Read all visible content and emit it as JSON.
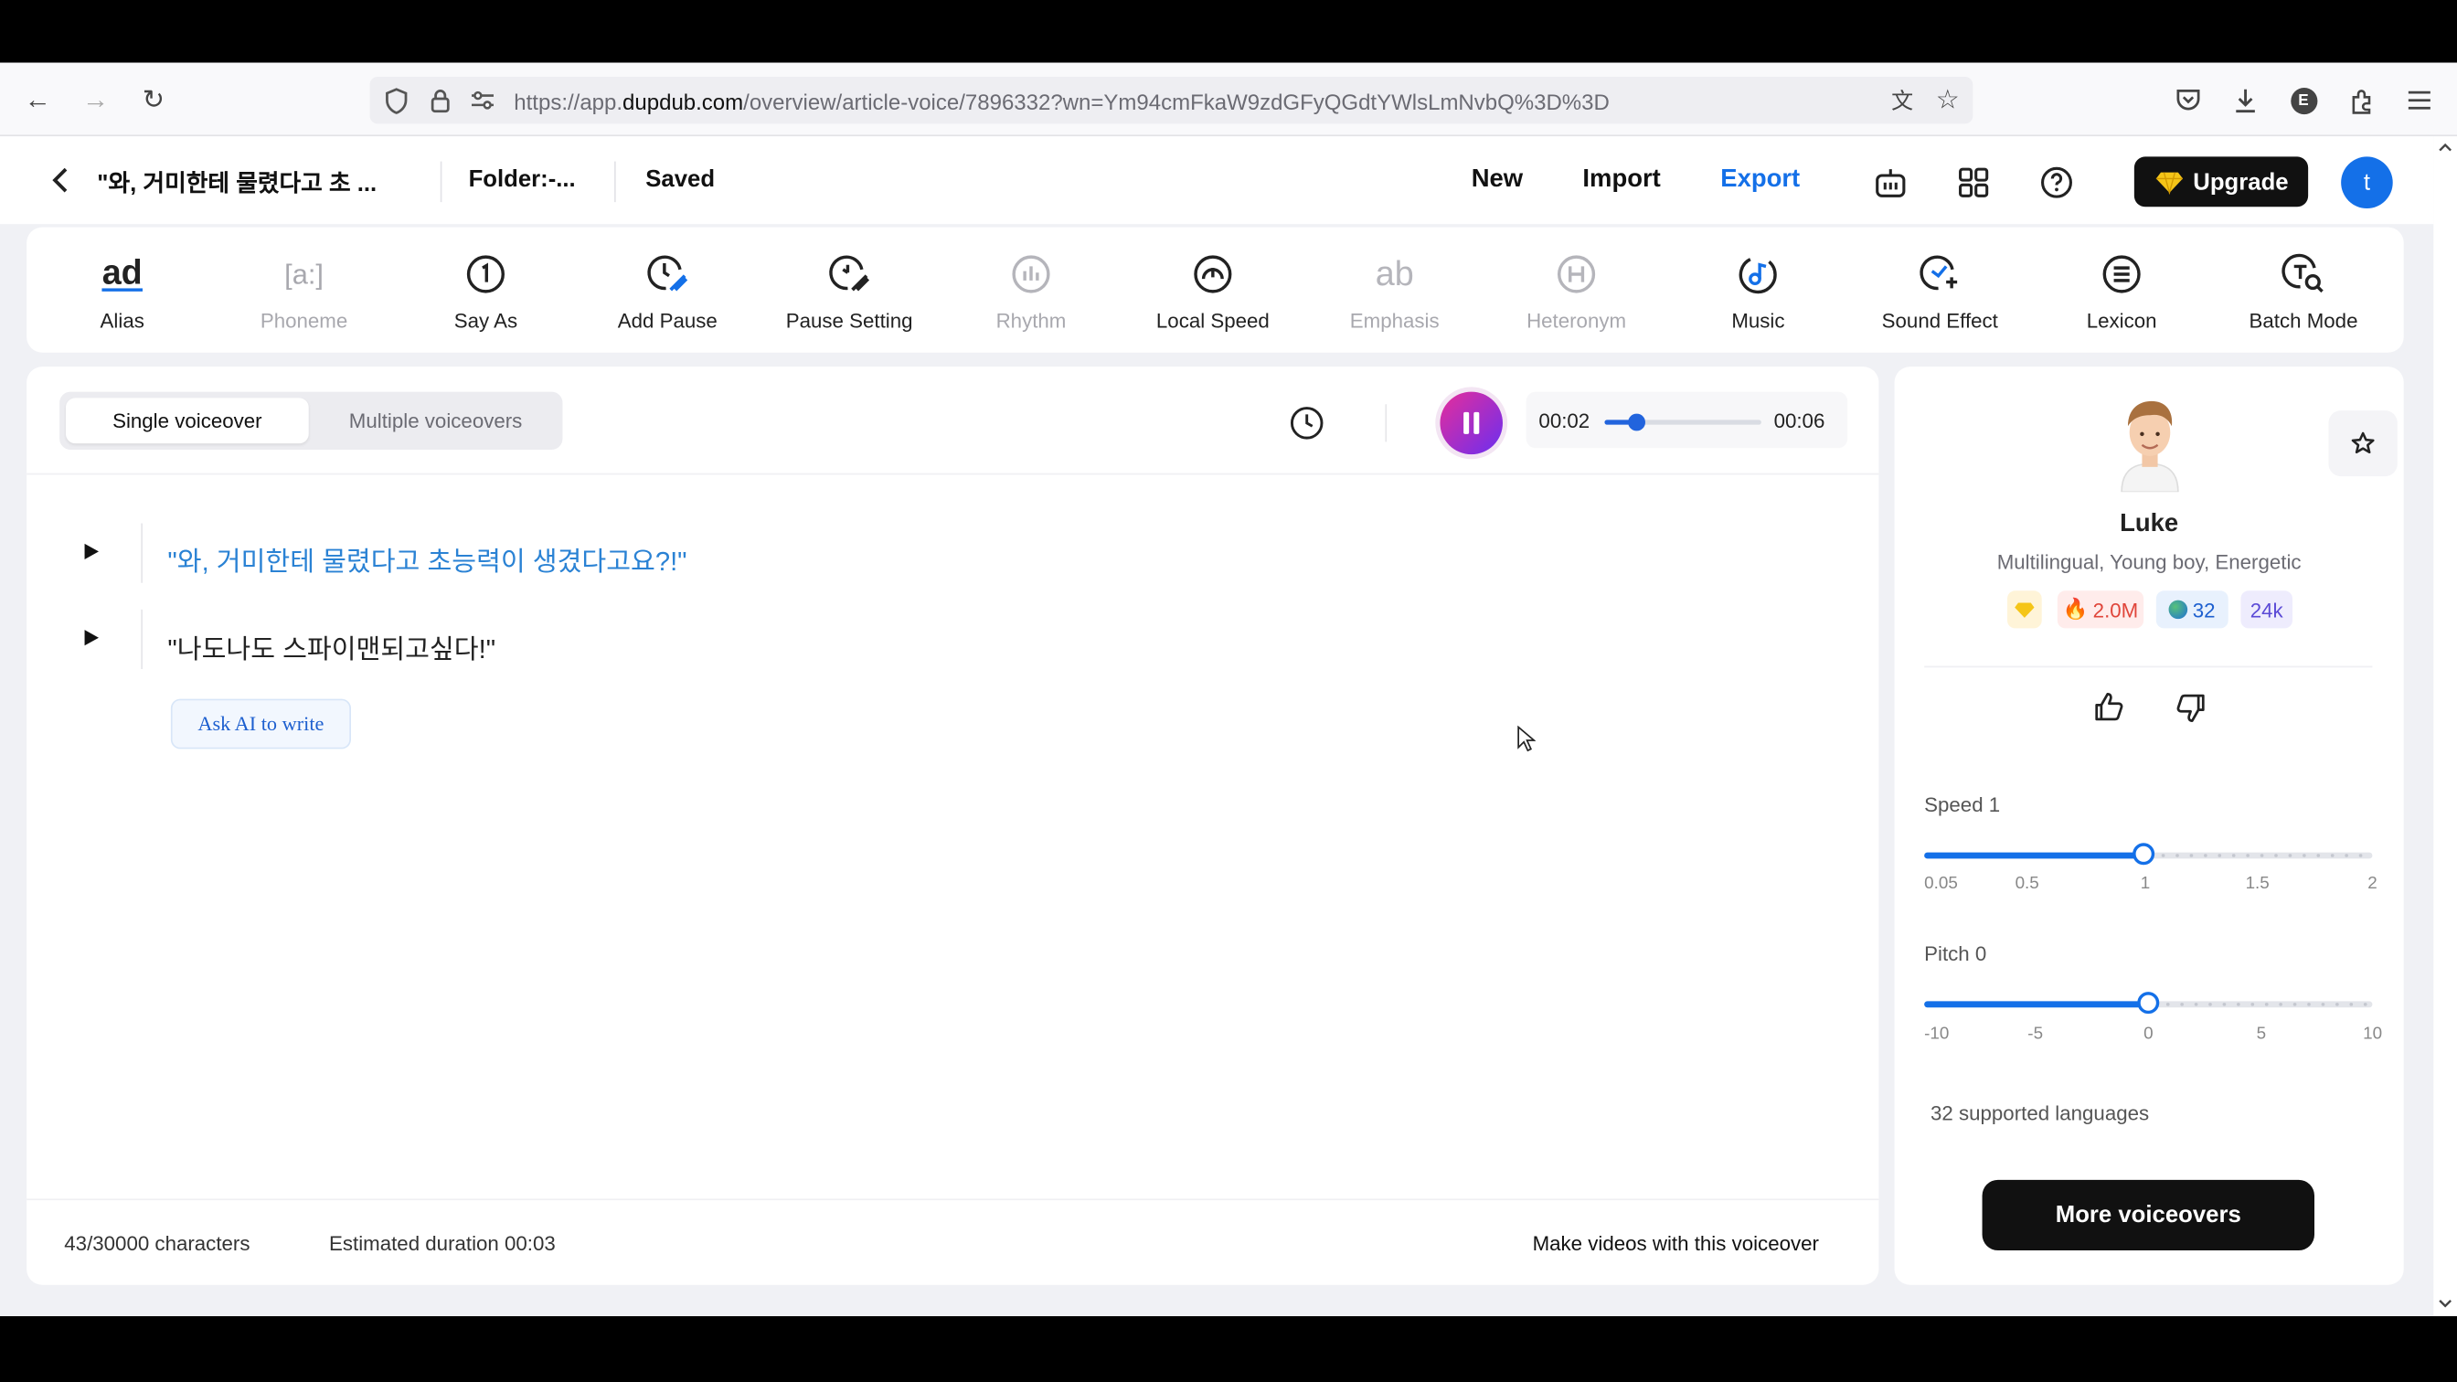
{
  "browser": {
    "url_prefix": "https://app.",
    "url_domain": "dupdub.com",
    "url_path": "/overview/article-voice/7896332?wn=Ym94cmFkaW9zdGFyQGdtYWlsLmNvbQ%3D%3D"
  },
  "header": {
    "title": "\"와, 거미한테 물렸다고 초 ...",
    "folder": "Folder:-...",
    "saved": "Saved",
    "new": "New",
    "import": "Import",
    "export": "Export",
    "upgrade": "Upgrade",
    "avatar_letter": "t",
    "accent": "#1470e8"
  },
  "toolbar": {
    "items": [
      {
        "label": "Alias",
        "icon": "alias-icon",
        "enabled": true
      },
      {
        "label": "Phoneme",
        "icon": "phoneme-icon",
        "enabled": false
      },
      {
        "label": "Say As",
        "icon": "say-as-icon",
        "enabled": true
      },
      {
        "label": "Add Pause",
        "icon": "add-pause-icon",
        "enabled": true
      },
      {
        "label": "Pause Setting",
        "icon": "pause-setting-icon",
        "enabled": true
      },
      {
        "label": "Rhythm",
        "icon": "rhythm-icon",
        "enabled": false
      },
      {
        "label": "Local Speed",
        "icon": "local-speed-icon",
        "enabled": true
      },
      {
        "label": "Emphasis",
        "icon": "emphasis-icon",
        "enabled": false
      },
      {
        "label": "Heteronym",
        "icon": "heteronym-icon",
        "enabled": false
      },
      {
        "label": "Music",
        "icon": "music-icon",
        "enabled": true
      },
      {
        "label": "Sound Effect",
        "icon": "sound-effect-icon",
        "enabled": true
      },
      {
        "label": "Lexicon",
        "icon": "lexicon-icon",
        "enabled": true
      },
      {
        "label": "Batch Mode",
        "icon": "batch-mode-icon",
        "enabled": true
      }
    ]
  },
  "editor": {
    "mode_single": "Single voiceover",
    "mode_multiple": "Multiple voiceovers",
    "player": {
      "current": "00:02",
      "total": "00:06",
      "progress": 0.2
    },
    "lines": [
      {
        "text": "\"와, 거미한테 물렸다고 초능력이 생겼다고요?!\"",
        "active": true
      },
      {
        "text": "\"나도나도 스파이맨되고싶다!\"",
        "active": false
      }
    ],
    "ask_ai": "Ask AI to write",
    "char_count": "43/30000 characters",
    "duration": "Estimated duration 00:03",
    "make_videos": "Make videos with this voiceover"
  },
  "voice": {
    "name": "Luke",
    "description": "Multilingual, Young boy, Energetic",
    "badges": {
      "plays": "2.0M",
      "languages": "32",
      "likes": "24k"
    },
    "speed": {
      "label": "Speed 1",
      "value": 1,
      "ticks": [
        "0.05",
        "0.5",
        "1",
        "1.5",
        "2"
      ],
      "position": 0.49
    },
    "pitch": {
      "label": "Pitch 0",
      "value": 0,
      "ticks": [
        "-10",
        "-5",
        "0",
        "5",
        "10"
      ],
      "position": 0.5
    },
    "supported": "32 supported languages",
    "more": "More voiceovers"
  }
}
